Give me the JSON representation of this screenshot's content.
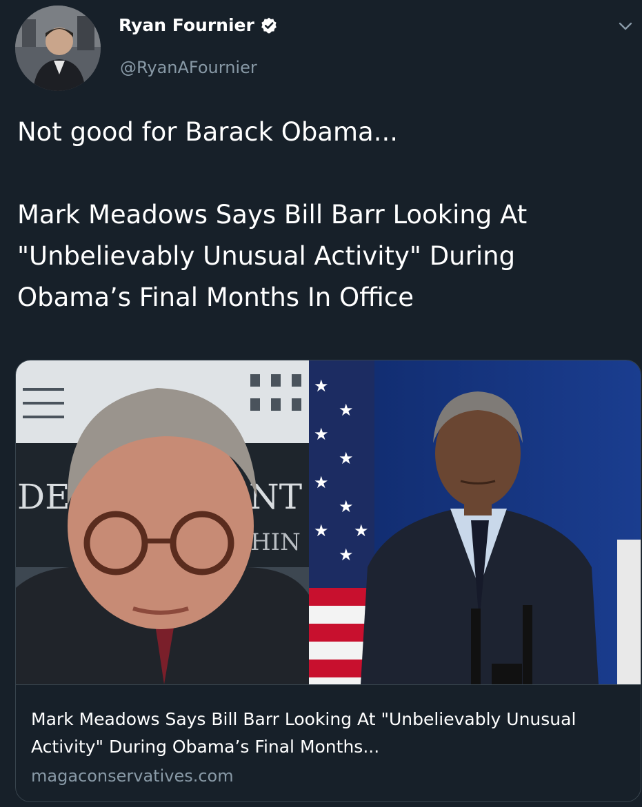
{
  "author": {
    "display_name": "Ryan Fournier",
    "handle": "@RyanAFournier",
    "verified": true
  },
  "tweet": {
    "line1": "Not good for Barack Obama...",
    "line2": "Mark Meadows Says Bill Barr Looking At \"Unbelievably Unusual Activity\" During Obama’s Final Months In Office"
  },
  "card": {
    "title": "Mark Meadows Says Bill Barr Looking At \"Unbelievably Unusual Activity\" During Obama’s Final Months...",
    "domain": "magaconservatives.com",
    "image_sign_text_left": "DEI",
    "image_sign_text_right": "NT",
    "image_sign_text_right2": "HIN"
  },
  "colors": {
    "background": "#172029",
    "secondary_text": "#8899a6",
    "verified": "#ffffff",
    "border": "#38444d"
  },
  "icons": {
    "verified": "verified-badge-icon",
    "menu": "chevron-down-icon"
  }
}
